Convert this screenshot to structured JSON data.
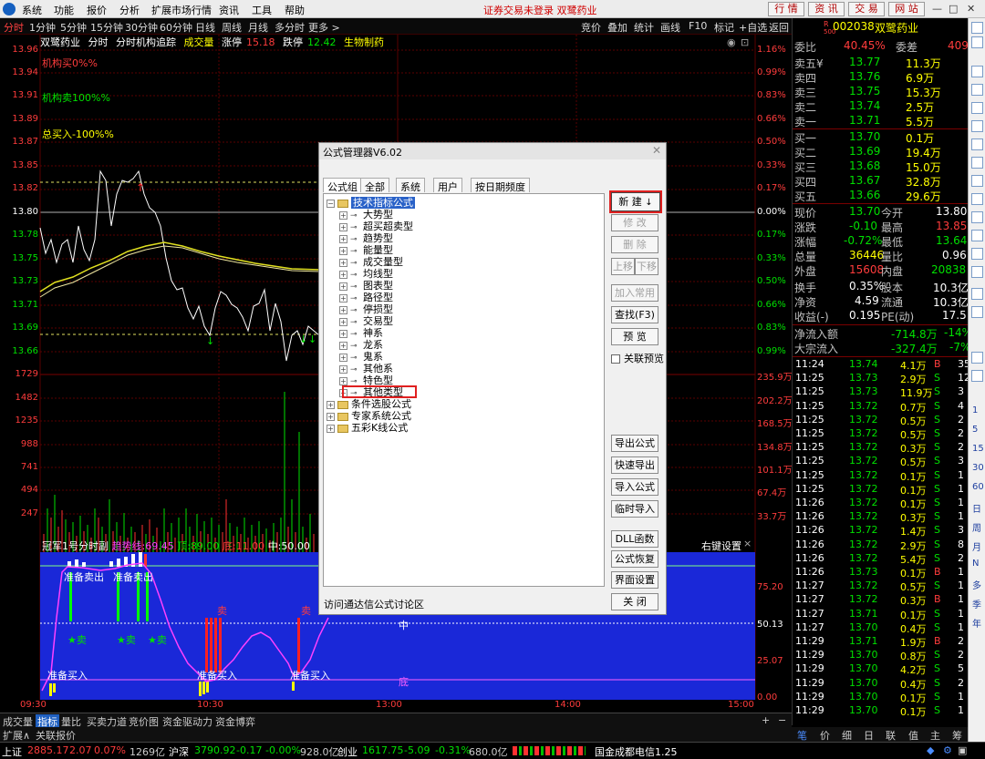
{
  "menubar": {
    "items": [
      "系统",
      "功能",
      "报价",
      "分析",
      "扩展市场行情",
      "资讯",
      "工具",
      "帮助"
    ],
    "center_text": "证券交易未登录  双鹭药业",
    "buttons": [
      "行 情",
      "资 讯",
      "交 易",
      "网 站"
    ]
  },
  "periodbar": {
    "items": [
      "分时",
      "1分钟",
      "5分钟",
      "15分钟",
      "30分钟",
      "60分钟",
      "日线",
      "周线",
      "月线",
      "多分时",
      "更多 >"
    ],
    "right": [
      "竞价",
      "叠加",
      "统计",
      "画线",
      "F10",
      "标记",
      "+自选",
      "返回"
    ]
  },
  "chart_info": {
    "name": "双鹭药业",
    "labels": [
      "分时",
      "分时机构追踪"
    ],
    "vol_label": "成交量",
    "zt_label": "涨停",
    "zt": "15.18",
    "dt_label": "跌停",
    "dt": "12.42",
    "sector": "生物制药"
  },
  "indicator_text": {
    "jgb": "机构买0%%",
    "jgs": "机构卖100%%",
    "zmr": "总买入-100%%"
  },
  "price_axis": [
    "13.96",
    "13.94",
    "13.91",
    "13.89",
    "13.87",
    "13.85",
    "13.82",
    "13.80",
    "13.78",
    "13.75",
    "13.73",
    "13.71",
    "13.69",
    "13.66"
  ],
  "pct_axis": [
    "1.16%",
    "0.99%",
    "0.83%",
    "0.66%",
    "0.50%",
    "0.33%",
    "0.17%",
    "0.00%",
    "0.17%",
    "0.33%",
    "0.50%",
    "0.66%",
    "0.83%",
    "0.99%"
  ],
  "vol_axis_left": [
    "1729",
    "1482",
    "1235",
    "988",
    "741",
    "494",
    "247"
  ],
  "vol_axis_right": [
    "235.9万",
    "202.2万",
    "168.5万",
    "134.8万",
    "101.1万",
    "67.4万",
    "33.7万"
  ],
  "lower": {
    "title": "冠军1号分时副",
    "trend_label": "趋势线:",
    "trend": "69.45",
    "top_label": "顶:",
    "top": "89.00",
    "bottom_label": "底:",
    "bottom": "11.00",
    "mid_label": "中:",
    "mid": "50.00",
    "right_label": "右键设置",
    "axis": [
      "75.20",
      "50.13",
      "25.07",
      "0.00"
    ],
    "ann": {
      "sell1": "准备卖出",
      "sell2": "准备卖出",
      "buy1": "准备买入",
      "buy2": "准备买入",
      "buy3": "准备买入",
      "sellk": "卖",
      "sellk2": "卖",
      "star1": "★卖",
      "star2": "★卖",
      "star3": "★卖",
      "zhong": "中",
      "di": "底"
    }
  },
  "time_axis": [
    "09:30",
    "10:30",
    "13:00",
    "14:00",
    "15:00"
  ],
  "dialog": {
    "title": "公式管理器V6.02",
    "tabs": [
      "公式组",
      "全部",
      "系统",
      "用户",
      "按日期频度"
    ],
    "tree_root": "技术指标公式",
    "children": [
      "大势型",
      "超买超卖型",
      "趋势型",
      "能量型",
      "成交量型",
      "均线型",
      "图表型",
      "路径型",
      "停损型",
      "交易型",
      "神系",
      "龙系",
      "鬼系",
      "其他系",
      "特色型",
      "其他类型"
    ],
    "groups": [
      "条件选股公式",
      "专家系统公式",
      "五彩K线公式"
    ],
    "buttons": {
      "new": "新 建",
      "edit": "修 改",
      "del": "删 除",
      "up": "上移",
      "down": "下移",
      "add_common": "加入常用",
      "find": "查找(F3)",
      "preview": "预 览",
      "linked": "关联预览",
      "export": "导出公式",
      "quick_export": "快速导出",
      "import": "导入公式",
      "temp_import": "临时导入",
      "dll": "DLL函数",
      "restore": "公式恢复",
      "ui": "界面设置",
      "close": "关 闭"
    },
    "footer": "访问通达信公式讨论区"
  },
  "quote": {
    "code": "002038",
    "name": "双鹭药业",
    "r_label": "R",
    "r_num": "500",
    "wb_label": "委比",
    "wb": "40.45%",
    "wc_label": "委差",
    "wc": "409",
    "sell": [
      {
        "l": "卖五¥",
        "p": "13.77",
        "v": "11.3万"
      },
      {
        "l": "卖四",
        "p": "13.76",
        "v": "6.9万"
      },
      {
        "l": "卖三",
        "p": "13.75",
        "v": "15.3万"
      },
      {
        "l": "卖二",
        "p": "13.74",
        "v": "2.5万"
      },
      {
        "l": "卖一",
        "p": "13.71",
        "v": "5.5万"
      }
    ],
    "buy": [
      {
        "l": "买一",
        "p": "13.70",
        "v": "0.1万"
      },
      {
        "l": "买二",
        "p": "13.69",
        "v": "19.4万"
      },
      {
        "l": "买三",
        "p": "13.68",
        "v": "15.0万"
      },
      {
        "l": "买四",
        "p": "13.67",
        "v": "32.8万"
      },
      {
        "l": "买五",
        "p": "13.66",
        "v": "29.6万"
      }
    ],
    "stats": [
      {
        "a": "现价",
        "av": "13.70",
        "b": "今开",
        "bv": "13.80"
      },
      {
        "a": "涨跌",
        "av": "-0.10",
        "b": "最高",
        "bv": "13.85"
      },
      {
        "a": "涨幅",
        "av": "-0.72%",
        "b": "最低",
        "bv": "13.64"
      },
      {
        "a": "总量",
        "av": "36446",
        "b": "量比",
        "bv": "0.96"
      },
      {
        "a": "外盘",
        "av": "15608",
        "b": "内盘",
        "bv": "20838"
      },
      {
        "a": "换手",
        "av": "0.35%",
        "b": "股本",
        "bv": "10.3亿"
      },
      {
        "a": "净资",
        "av": "4.59",
        "b": "流通",
        "bv": "10.3亿"
      },
      {
        "a": "收益(-)",
        "av": "0.195",
        "b": "PE(动)",
        "bv": "17.5"
      }
    ],
    "flow": [
      {
        "a": "净流入额",
        "v": "-714.8万",
        "p": "-14%"
      },
      {
        "a": "大宗流入",
        "v": "-327.4万",
        "p": "-7%"
      }
    ],
    "ticks": [
      {
        "t": "11:24",
        "p": "13.74",
        "v": "4.1万",
        "d": "B",
        "n": "35"
      },
      {
        "t": "11:25",
        "p": "13.73",
        "v": "2.9万",
        "d": "S",
        "n": "12"
      },
      {
        "t": "11:25",
        "p": "13.73",
        "v": "11.9万",
        "d": "S",
        "n": "3"
      },
      {
        "t": "11:25",
        "p": "13.72",
        "v": "0.7万",
        "d": "S",
        "n": "4"
      },
      {
        "t": "11:25",
        "p": "13.72",
        "v": "0.5万",
        "d": "S",
        "n": "2"
      },
      {
        "t": "11:25",
        "p": "13.72",
        "v": "0.5万",
        "d": "S",
        "n": "2"
      },
      {
        "t": "11:25",
        "p": "13.72",
        "v": "0.3万",
        "d": "S",
        "n": "2"
      },
      {
        "t": "11:25",
        "p": "13.72",
        "v": "0.5万",
        "d": "S",
        "n": "3"
      },
      {
        "t": "11:25",
        "p": "13.72",
        "v": "0.1万",
        "d": "S",
        "n": "1"
      },
      {
        "t": "11:25",
        "p": "13.72",
        "v": "0.1万",
        "d": "S",
        "n": "1"
      },
      {
        "t": "11:26",
        "p": "13.72",
        "v": "0.1万",
        "d": "S",
        "n": "1"
      },
      {
        "t": "11:26",
        "p": "13.72",
        "v": "0.3万",
        "d": "S",
        "n": "1"
      },
      {
        "t": "11:26",
        "p": "13.72",
        "v": "1.4万",
        "d": "S",
        "n": "3"
      },
      {
        "t": "11:26",
        "p": "13.72",
        "v": "2.9万",
        "d": "S",
        "n": "8"
      },
      {
        "t": "11:26",
        "p": "13.72",
        "v": "5.4万",
        "d": "S",
        "n": "2"
      },
      {
        "t": "11:26",
        "p": "13.73",
        "v": "0.1万",
        "d": "B",
        "n": "1"
      },
      {
        "t": "11:27",
        "p": "13.72",
        "v": "0.5万",
        "d": "S",
        "n": "1"
      },
      {
        "t": "11:27",
        "p": "13.72",
        "v": "0.3万",
        "d": "B",
        "n": "1"
      },
      {
        "t": "11:27",
        "p": "13.71",
        "v": "0.1万",
        "d": "S",
        "n": "1"
      },
      {
        "t": "11:27",
        "p": "13.70",
        "v": "0.4万",
        "d": "S",
        "n": "1"
      },
      {
        "t": "11:29",
        "p": "13.71",
        "v": "1.9万",
        "d": "B",
        "n": "2"
      },
      {
        "t": "11:29",
        "p": "13.70",
        "v": "0.8万",
        "d": "S",
        "n": "2"
      },
      {
        "t": "11:29",
        "p": "13.70",
        "v": "4.2万",
        "d": "S",
        "n": "5"
      },
      {
        "t": "11:29",
        "p": "13.70",
        "v": "0.4万",
        "d": "S",
        "n": "2"
      },
      {
        "t": "11:29",
        "p": "13.70",
        "v": "0.1万",
        "d": "S",
        "n": "1"
      },
      {
        "t": "11:29",
        "p": "13.70",
        "v": "0.1万",
        "d": "S",
        "n": "1"
      }
    ]
  },
  "strip_labels": [
    "1",
    "5",
    "15",
    "30",
    "60",
    "日",
    "周",
    "月",
    "N",
    "多",
    "季",
    "年"
  ],
  "tabbar": [
    "成交量",
    "指标",
    "量比",
    "买卖力道",
    "竞价图",
    "资金驱动力",
    "资金博弈"
  ],
  "tabbar2": [
    "扩展∧",
    "关联报价"
  ],
  "rtabs": [
    "笔",
    "价",
    "细",
    "日",
    "联",
    "值",
    "主",
    "筹"
  ],
  "status": {
    "sh_label": "上证",
    "sh": "2885.17",
    "sh_chg": "2.07",
    "sh_pct": "0.07%",
    "sh_amt": "1269亿",
    "sz_label": "沪深",
    "sz": "3790.92",
    "sz_chg": "-0.17",
    "sz_pct": "-0.00%",
    "sz_amt": "928.0亿",
    "cy_label": "创业",
    "cy": "1617.75",
    "cy_chg": "-5.09",
    "cy_pct": "-0.31%",
    "cy_amt": "680.0亿",
    "news": "国金成都电信1.25"
  },
  "colors": {
    "up": "#ff3c3c",
    "down": "#00e000",
    "bg": "#000000",
    "panel_blue": "#1a28d8",
    "select": "#2a62c8"
  }
}
